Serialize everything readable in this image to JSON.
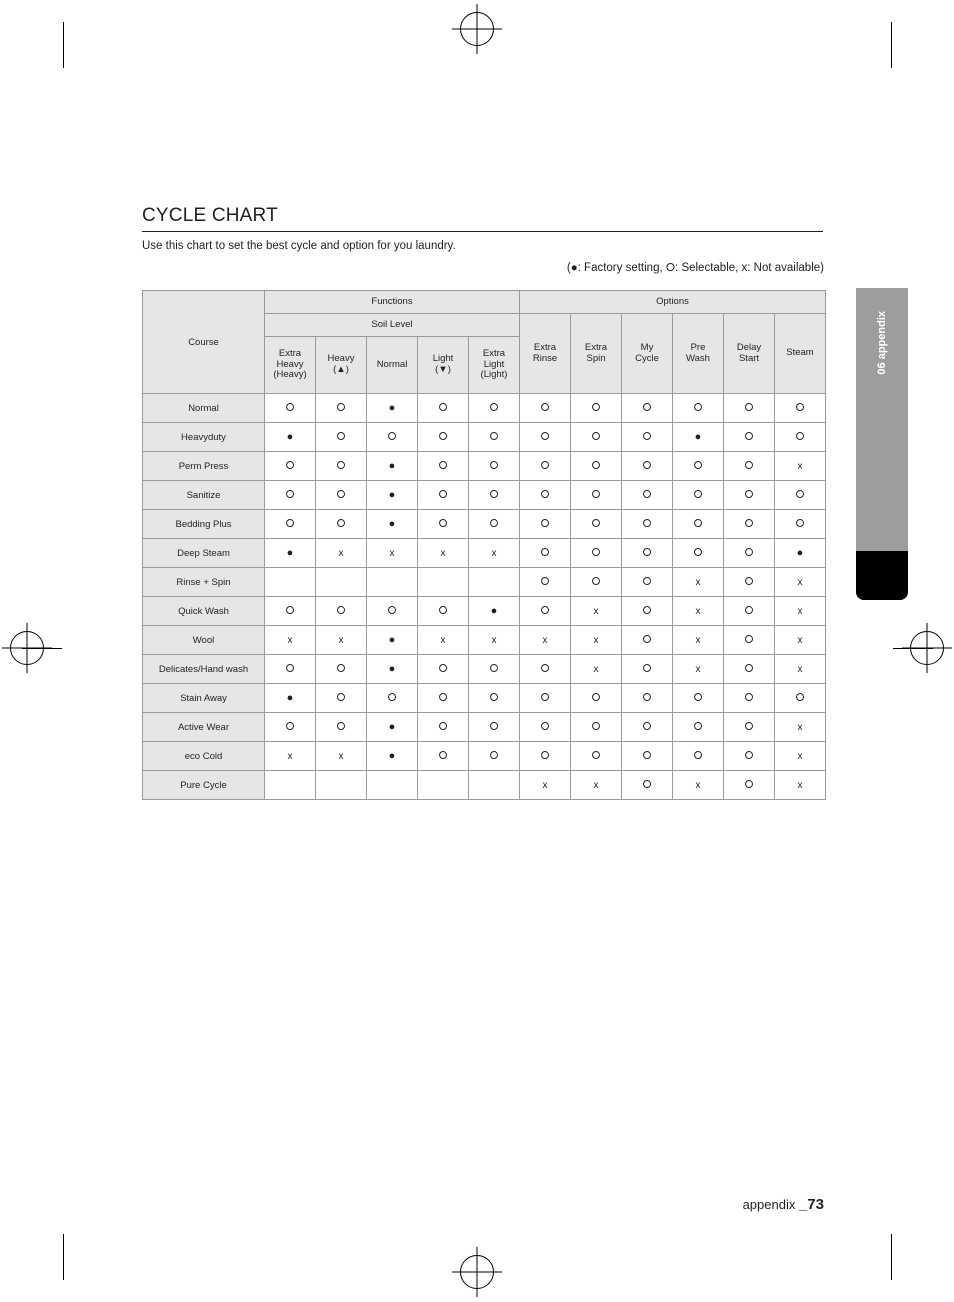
{
  "document": {
    "title": "CYCLE CHART",
    "intro": "Use this chart to set the best cycle and option for you laundry.",
    "legend": "(●: Factory setting, ⭘: Selectable, x: Not available)",
    "side_tab": "06 appendix",
    "footer_label": "appendix",
    "footer_page": "_73"
  },
  "table": {
    "group_headers": {
      "course": "Course",
      "functions": "Functions",
      "options": "Options",
      "soil_level": "Soil Level"
    },
    "soil_columns": [
      "Extra\nHeavy\n(Heavy)",
      "Heavy\n(▲)",
      "Normal",
      "Light\n(▼)",
      "Extra\nLight\n(Light)"
    ],
    "soil_columns_lines": [
      [
        "Extra",
        "Heavy",
        "(Heavy)"
      ],
      [
        "Heavy",
        "(▲)"
      ],
      [
        "Normal"
      ],
      [
        "Light",
        "(▼)"
      ],
      [
        "Extra",
        "Light",
        "(Light)"
      ]
    ],
    "option_columns_lines": [
      [
        "Extra",
        "Rinse"
      ],
      [
        "Extra",
        "Spin"
      ],
      [
        "My",
        "Cycle"
      ],
      [
        "Pre",
        "Wash"
      ],
      [
        "Delay",
        "Start"
      ],
      [
        "Steam"
      ]
    ],
    "symbols": {
      "factory": "●",
      "selectable": "⭘",
      "not_available": "x",
      "blank": ""
    },
    "rows": [
      {
        "course": "Normal",
        "cells": [
          "O",
          "O",
          "F",
          "O",
          "O",
          "O",
          "O",
          "O",
          "O",
          "O",
          "O"
        ]
      },
      {
        "course": "Heavyduty",
        "cells": [
          "F",
          "O",
          "O",
          "O",
          "O",
          "O",
          "O",
          "O",
          "F",
          "O",
          "O"
        ]
      },
      {
        "course": "Perm Press",
        "cells": [
          "O",
          "O",
          "F",
          "O",
          "O",
          "O",
          "O",
          "O",
          "O",
          "O",
          "X"
        ]
      },
      {
        "course": "Sanitize",
        "cells": [
          "O",
          "O",
          "F",
          "O",
          "O",
          "O",
          "O",
          "O",
          "O",
          "O",
          "O"
        ]
      },
      {
        "course": "Bedding Plus",
        "cells": [
          "O",
          "O",
          "F",
          "O",
          "O",
          "O",
          "O",
          "O",
          "O",
          "O",
          "O"
        ]
      },
      {
        "course": "Deep Steam",
        "cells": [
          "F",
          "X",
          "X",
          "X",
          "X",
          "O",
          "O",
          "O",
          "O",
          "O",
          "F"
        ]
      },
      {
        "course": "Rinse + Spin",
        "cells": [
          "B",
          "B",
          "B",
          "B",
          "B",
          "O",
          "O",
          "O",
          "X",
          "O",
          "X"
        ]
      },
      {
        "course": "Quick Wash",
        "cells": [
          "O",
          "O",
          "O",
          "O",
          "F",
          "O",
          "X",
          "O",
          "X",
          "O",
          "X"
        ]
      },
      {
        "course": "Wool",
        "cells": [
          "X",
          "X",
          "F",
          "X",
          "X",
          "X",
          "X",
          "O",
          "X",
          "O",
          "X"
        ]
      },
      {
        "course": "Delicates/Hand wash",
        "cells": [
          "O",
          "O",
          "F",
          "O",
          "O",
          "O",
          "X",
          "O",
          "X",
          "O",
          "X"
        ]
      },
      {
        "course": "Stain Away",
        "cells": [
          "F",
          "O",
          "O",
          "O",
          "O",
          "O",
          "O",
          "O",
          "O",
          "O",
          "O"
        ]
      },
      {
        "course": "Active Wear",
        "cells": [
          "O",
          "O",
          "F",
          "O",
          "O",
          "O",
          "O",
          "O",
          "O",
          "O",
          "X"
        ]
      },
      {
        "course": "eco Cold",
        "cells": [
          "X",
          "X",
          "F",
          "O",
          "O",
          "O",
          "O",
          "O",
          "O",
          "O",
          "X"
        ]
      },
      {
        "course": "Pure Cycle",
        "cells": [
          "B",
          "B",
          "B",
          "B",
          "B",
          "X",
          "X",
          "O",
          "X",
          "O",
          "X"
        ]
      }
    ]
  }
}
